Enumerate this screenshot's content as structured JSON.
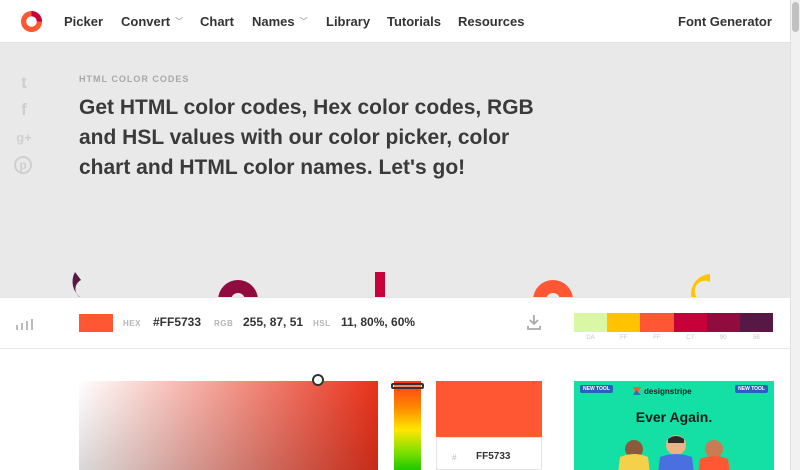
{
  "nav": {
    "items": [
      {
        "label": "Picker"
      },
      {
        "label": "Convert",
        "has_dropdown": true
      },
      {
        "label": "Chart"
      },
      {
        "label": "Names",
        "has_dropdown": true
      },
      {
        "label": "Library"
      },
      {
        "label": "Tutorials"
      },
      {
        "label": "Resources"
      }
    ],
    "right_link": "Font Generator",
    "dropdown_glyph": "﹀"
  },
  "social": {
    "twitter": "t",
    "facebook": "f",
    "googleplus": "g+",
    "pinterest": "p"
  },
  "hero": {
    "eyebrow": "HTML COLOR CODES",
    "headline": "Get HTML color codes, Hex color codes, RGB and HSL values with our color picker, color chart and HTML color names. Let's go!"
  },
  "current_color": {
    "swatch": "#FF5733",
    "hex_label": "HEX",
    "hex": "#FF5733",
    "rgb_label": "RGB",
    "rgb": "255, 87, 51",
    "hsl_label": "HSL",
    "hsl": "11, 80%, 60%"
  },
  "palette": {
    "colors": [
      "#DAF7A6",
      "#FFC300",
      "#FF5733",
      "#C70039",
      "#900C3F",
      "#581845"
    ],
    "labels": [
      "DA",
      "FF",
      "FF",
      "C7",
      "90",
      "58"
    ]
  },
  "picker": {
    "preview_color": "#FF5733",
    "preview_hash": "#",
    "preview_hex": "FF5733"
  },
  "ad": {
    "tag_left": "NEW TOOL",
    "tag_right": "NEW TOOL",
    "brand": "designstripe",
    "title": "Ever Again."
  },
  "colors": {
    "accent": "#FF5733",
    "ad_bg": "#14E0A6"
  }
}
